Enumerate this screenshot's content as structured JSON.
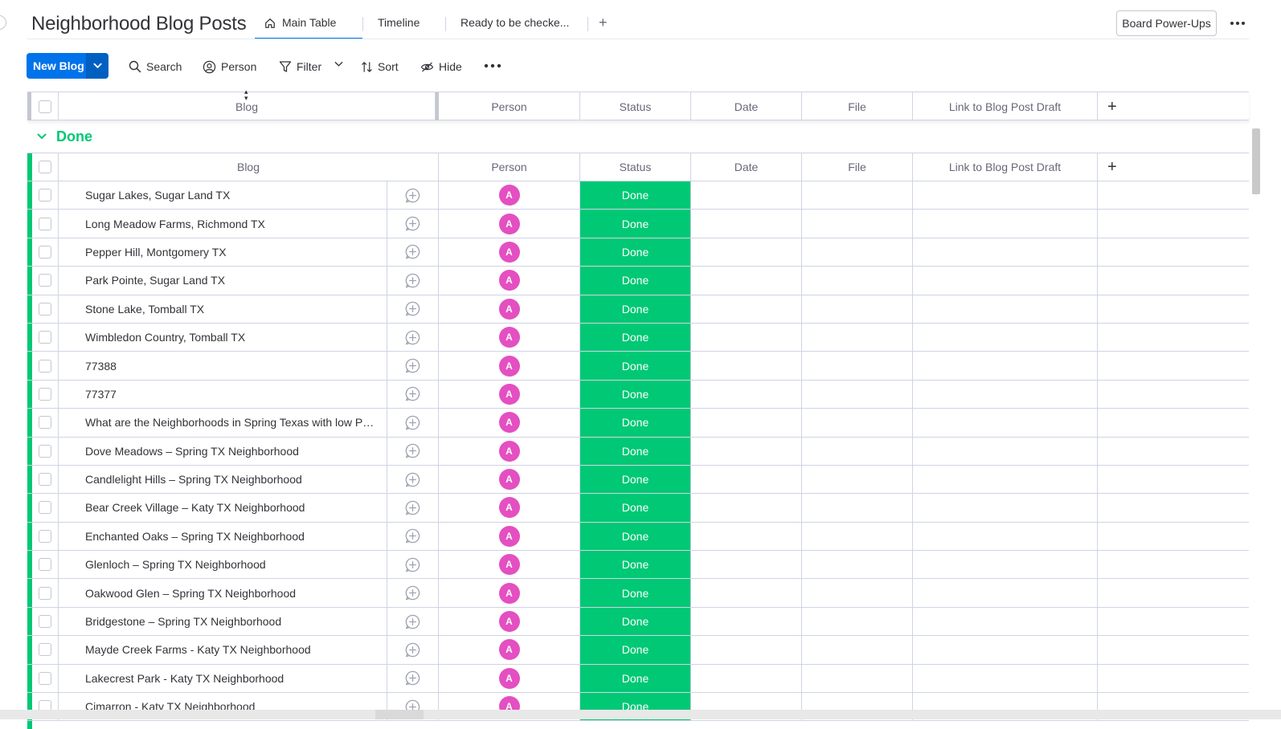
{
  "board": {
    "title": "Neighborhood Blog Posts",
    "tabs": [
      {
        "label": "Main Table",
        "icon": "home-icon",
        "active": true
      },
      {
        "label": "Timeline"
      },
      {
        "label": "Ready to be checke..."
      }
    ],
    "add_tab": "+",
    "powerups_label": "Board Power-Ups",
    "more_icon": "more-horizontal-icon"
  },
  "toolbar": {
    "new_item_label": "New Blog",
    "search_label": "Search",
    "person_label": "Person",
    "filter_label": "Filter",
    "sort_label": "Sort",
    "hide_label": "Hide"
  },
  "columns": {
    "name": "Blog",
    "person": "Person",
    "status": "Status",
    "date": "Date",
    "file": "File",
    "link": "Link to Blog Post Draft",
    "add": "+"
  },
  "group": {
    "name": "Done",
    "color": "#00c875",
    "items": [
      {
        "name": "Sugar Lakes, Sugar Land TX",
        "person": "A",
        "status": "Done"
      },
      {
        "name": "Long Meadow Farms, Richmond TX",
        "person": "A",
        "status": "Done"
      },
      {
        "name": "Pepper Hill, Montgomery TX",
        "person": "A",
        "status": "Done"
      },
      {
        "name": "Park Pointe, Sugar Land TX",
        "person": "A",
        "status": "Done"
      },
      {
        "name": "Stone Lake, Tomball TX",
        "person": "A",
        "status": "Done"
      },
      {
        "name": "Wimbledon Country, Tomball TX",
        "person": "A",
        "status": "Done"
      },
      {
        "name": "77388",
        "person": "A",
        "status": "Done"
      },
      {
        "name": "77377",
        "person": "A",
        "status": "Done"
      },
      {
        "name": "What are the Neighborhoods in Spring Texas with low Pro...",
        "person": "A",
        "status": "Done"
      },
      {
        "name": "Dove Meadows – Spring TX Neighborhood",
        "person": "A",
        "status": "Done"
      },
      {
        "name": "Candlelight Hills – Spring TX Neighborhood",
        "person": "A",
        "status": "Done"
      },
      {
        "name": "Bear Creek Village – Katy TX Neighborhood",
        "person": "A",
        "status": "Done"
      },
      {
        "name": "Enchanted Oaks – Spring TX Neighborhood",
        "person": "A",
        "status": "Done"
      },
      {
        "name": "Glenloch – Spring TX Neighborhood",
        "person": "A",
        "status": "Done"
      },
      {
        "name": "Oakwood Glen – Spring TX Neighborhood",
        "person": "A",
        "status": "Done"
      },
      {
        "name": "Bridgestone – Spring TX Neighborhood",
        "person": "A",
        "status": "Done"
      },
      {
        "name": "Mayde Creek Farms - Katy TX Neighborhood",
        "person": "A",
        "status": "Done"
      },
      {
        "name": "Lakecrest Park - Katy TX Neighborhood",
        "person": "A",
        "status": "Done"
      },
      {
        "name": "Cimarron - Katy TX Neighborhood",
        "person": "A",
        "status": "Done"
      }
    ]
  },
  "colors": {
    "accent": "#0073ea",
    "done_status": "#00c875",
    "avatar": "#e44fc1"
  }
}
